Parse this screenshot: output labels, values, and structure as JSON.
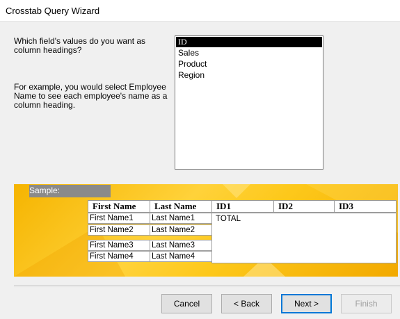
{
  "window": {
    "title": "Crosstab Query Wizard"
  },
  "prompt": "Which field's values do you want as column headings?",
  "example": "For example, you would select Employee Name to see each employee's name as a column heading.",
  "fields": [
    "ID",
    "Sales",
    "Product",
    "Region"
  ],
  "selected_field": "ID",
  "sample": {
    "label": "Sample:",
    "row_headers": [
      "First Name",
      "Last Name"
    ],
    "column_headers": [
      "ID1",
      "ID2",
      "ID3"
    ],
    "rows": [
      [
        "First Name1",
        "Last Name1"
      ],
      [
        "First Name2",
        "Last Name2"
      ],
      [
        "First Name3",
        "Last Name3"
      ],
      [
        "First Name4",
        "Last Name4"
      ]
    ],
    "total_label": "TOTAL"
  },
  "buttons": {
    "cancel": "Cancel",
    "back": "< Back",
    "next": "Next >",
    "finish": "Finish"
  },
  "colors": {
    "sample_bg": "#fdc81a",
    "selection": "#000000",
    "default_button_border": "#0078d7"
  }
}
